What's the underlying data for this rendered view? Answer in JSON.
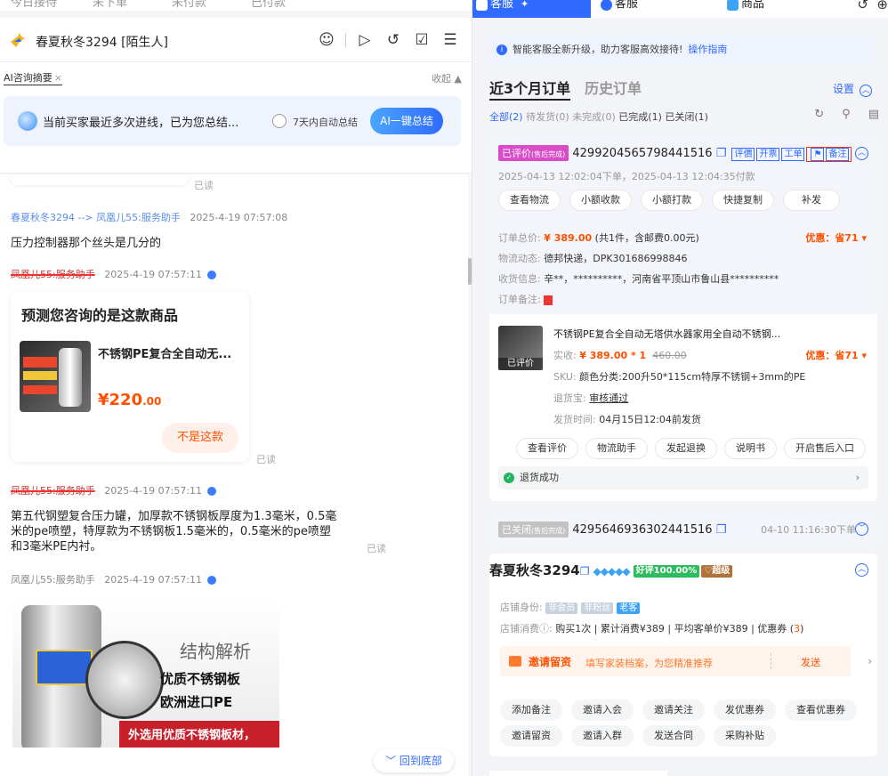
{
  "left": {
    "top_tabs": [
      "今日接待",
      "未下单",
      "未付款",
      "已付款"
    ],
    "header": {
      "title": "春夏秋冬3294 [陌生人]"
    },
    "ai": {
      "tab_label": "AI咨询摘要",
      "collapse": "收起 ▲",
      "message": "当前买家最近多次进线，已为您总结...",
      "auto_label": "7天内自动总结",
      "button": "AI一键总结"
    },
    "chat": {
      "read_label": "已读",
      "msg1_meta_from": "春夏秋冬3294 --> 凤凰儿55:服务助手",
      "msg1_meta_time": "2025-4-19 07:57:08",
      "msg1_text": "压力控制器那个丝头是几分的",
      "msg2_meta_from": "凤凰儿55:服务助手",
      "msg2_meta_time": "2025-4-19 07:57:11",
      "card_title": "预测您咨询的是这款商品",
      "card_product": "不锈钢PE复合全自动无...",
      "card_price_int": "¥220",
      "card_price_dec": ".00",
      "card_button": "不是这款",
      "msg3_meta_from": "凤凰儿55:服务助手",
      "msg3_meta_time": "2025-4-19 07:57:11",
      "msg3_line1": "第五代钢塑复合压力罐，加厚款不锈钢板厚度为1.3毫米，0.5毫",
      "msg3_line2": "米的pe喷塑，特厚款为不锈钢板1.5毫米的，0.5毫米的pe喷塑",
      "msg3_line3": "和3毫米PE内衬。",
      "msg4_meta_from": "凤凰儿55:服务助手",
      "msg4_meta_time": "2025-4-19 07:57:11",
      "image_text1": "结构解析",
      "image_text2": "优质不锈钢板",
      "image_text3": "欧洲进口PE",
      "image_text4": "外选用优质不锈钢板材，",
      "to_bottom": "﹀ 回到底部"
    }
  },
  "right": {
    "tabs": [
      {
        "label": "客服",
        "pin": "✦"
      },
      {
        "label": "客服"
      },
      {
        "label": "商品"
      }
    ],
    "notice": {
      "text": "智能客服全新升级，助力客服高效接待!",
      "link": "操作指南"
    },
    "order_tabs": [
      "近3个月订单",
      "历史订单"
    ],
    "settings": "设置",
    "filters": {
      "all": "全部(2)",
      "pending_ship": "待发货(0)",
      "unfinished": "未完成(0)",
      "done": "已完成(1)",
      "closed": "已关闭(1)"
    },
    "order1": {
      "status": "已评价",
      "status_sub": "(售后完成)",
      "number": "4299204565798441516",
      "tags": [
        "评價",
        "开票",
        "工单",
        "备注"
      ],
      "time": "2025-04-13 12:02:04下单，2025-04-13 12:04:35付款",
      "buttons": [
        "查看物流",
        "小额收款",
        "小额打款",
        "快捷复制",
        "补发"
      ],
      "total_label": "订单总价:",
      "total_value": "¥ 389.00",
      "total_detail": "(共1件，含邮费0.00元)",
      "discount": "优惠：省71",
      "logistics_label": "物流动态:",
      "logistics_value": "德邦快递，DPK301686998846",
      "address_label": "收货信息:",
      "address_value": "辛**，**********，河南省平顶山市鲁山县**********",
      "remark_label": "订单备注:",
      "product_title": "不锈钢PE复合全自动无塔供水器家用全自动不锈钢...",
      "product_badge": "已评价",
      "actual_label": "实收:",
      "actual_value": "¥ 389.00 * 1",
      "original_price": "460.00",
      "product_discount": "优惠：省71",
      "sku_label": "SKU:",
      "sku_value": "颜色分类:200升50*115cm特厚不锈钢+3mm的PE",
      "refund_treasure_label": "退货宝:",
      "refund_treasure_value": "审核通过",
      "ship_label": "发货时间:",
      "ship_value": "04月15日12:04前发货",
      "product_buttons": [
        "查看评价",
        "物流助手",
        "发起退换",
        "说明书",
        "开启售后入口"
      ],
      "refund_status": "退货成功"
    },
    "order2": {
      "status": "已关闭",
      "status_sub": "(售后完成)",
      "number": "4295646936302441516",
      "time": "04-10 11:16:30下单"
    },
    "customer": {
      "name": "春夏秋冬3294",
      "diamonds": "◆◆◆◆◆",
      "rate": "好评100.00%",
      "vip": "♡超级",
      "identity_label": "店铺身份:",
      "identity_tags": [
        "非会员",
        "非粉丝",
        "老客"
      ],
      "consume_label": "店铺消费ⓘ:",
      "consume_value_1": "购买1次 | 累计消费¥389 | 平均客单价¥389 | 优惠券 (",
      "coupon_count": "3",
      "consume_value_2": ")",
      "invite_title": "邀请留资",
      "invite_desc": "填写家装档案，为您精准推荐",
      "invite_send": "发送",
      "buttons_row1": [
        "添加备注",
        "邀请入会",
        "邀请关注",
        "发优惠券",
        "查看优惠券"
      ],
      "buttons_row2": [
        "邀请留资",
        "邀请入群",
        "发送合同",
        "采购补贴"
      ]
    },
    "colors": {
      "accent": "#2f6bff",
      "price": "#ff5000",
      "review_badge": "#d94cc8"
    }
  }
}
